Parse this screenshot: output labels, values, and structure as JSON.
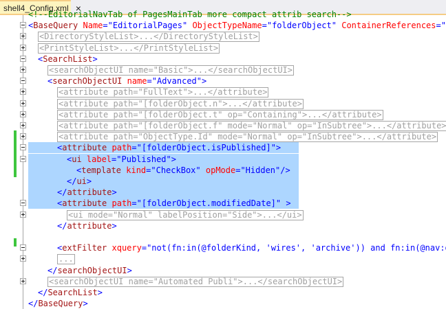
{
  "tab": {
    "title": "shell4_Config.xml",
    "close_glyph": "×"
  },
  "lines": [
    {
      "indent": 0,
      "fold": "none",
      "tokens": [
        [
          "c",
          "<!--EditorialNavTab of PagesMainTab more compact attrib search-->"
        ]
      ]
    },
    {
      "indent": 0,
      "fold": "minus",
      "tokens": [
        [
          "b",
          "<"
        ],
        [
          "t",
          "BaseQuery"
        ],
        [
          "a",
          " Name"
        ],
        [
          "b",
          "=\""
        ],
        [
          "v2",
          "EditorialPages"
        ],
        [
          "b",
          "\""
        ],
        [
          "a",
          " ObjectTypeName"
        ],
        [
          "b",
          "=\""
        ],
        [
          "v2",
          "folderObject"
        ],
        [
          "b",
          "\""
        ],
        [
          "a",
          " ContainerReferences"
        ],
        [
          "b",
          "=\"f"
        ]
      ]
    },
    {
      "indent": 1,
      "fold": "plus",
      "box": "<DirectoryStyleList>...</DirectoryStyleList>"
    },
    {
      "indent": 1,
      "fold": "plus",
      "box": "<PrintStyleList>...</PrintStyleList>"
    },
    {
      "indent": 1,
      "fold": "minus",
      "tokens": [
        [
          "b",
          "<"
        ],
        [
          "t",
          "SearchList"
        ],
        [
          "b",
          ">"
        ]
      ]
    },
    {
      "indent": 2,
      "fold": "plus",
      "box": "<searchObjectUI name=\"Basic\">...</searchObjectUI>"
    },
    {
      "indent": 2,
      "fold": "minus",
      "tokens": [
        [
          "b",
          "<"
        ],
        [
          "t",
          "searchObjectUI"
        ],
        [
          "a",
          " name"
        ],
        [
          "b",
          "=\""
        ],
        [
          "v2",
          "Advanced"
        ],
        [
          "b",
          "\">"
        ]
      ]
    },
    {
      "indent": 3,
      "fold": "plus",
      "box": "<attribute path=\"FullText\">...</attribute>"
    },
    {
      "indent": 3,
      "fold": "plus",
      "box": "<attribute path=\"[folderObject.n\">...</attribute>"
    },
    {
      "indent": 3,
      "fold": "plus",
      "box": "<attribute path=\"[folderObject.t\" op=\"Containing\">...</attribute>"
    },
    {
      "indent": 3,
      "fold": "plus",
      "box": "<attribute path=\"[folderObject.f\" mode=\"Normal\" op=\"InSubtree\">...</attribute>"
    },
    {
      "indent": 3,
      "fold": "plus",
      "box": "<attribute path=\"ObjectType.Id\" mode=\"Normal\" op=\"InSubtree\">...</attribute>"
    },
    {
      "indent": 3,
      "fold": "minus",
      "selected": true,
      "tokens": [
        [
          "b",
          "<"
        ],
        [
          "t",
          "attribute"
        ],
        [
          "a",
          " path"
        ],
        [
          "b",
          "=\""
        ],
        [
          "v2",
          "[folderObject.isPublished]"
        ],
        [
          "b",
          "\">"
        ]
      ]
    },
    {
      "indent": 4,
      "fold": "minus",
      "selected": true,
      "tokens": [
        [
          "b",
          "<"
        ],
        [
          "t",
          "ui"
        ],
        [
          "a",
          " label"
        ],
        [
          "b",
          "=\""
        ],
        [
          "v2",
          "Published"
        ],
        [
          "b",
          "\">"
        ]
      ]
    },
    {
      "indent": 5,
      "fold": "none",
      "selected": true,
      "tokens": [
        [
          "b",
          "<"
        ],
        [
          "t",
          "template"
        ],
        [
          "a",
          " kind"
        ],
        [
          "b",
          "=\""
        ],
        [
          "v2",
          "CheckBox"
        ],
        [
          "b",
          "\""
        ],
        [
          "a",
          " opMode"
        ],
        [
          "b",
          "=\""
        ],
        [
          "v2",
          "Hidden"
        ],
        [
          "b",
          "\"/>"
        ]
      ]
    },
    {
      "indent": 4,
      "fold": "none",
      "selected": true,
      "tokens": [
        [
          "b",
          "</"
        ],
        [
          "t",
          "ui"
        ],
        [
          "b",
          ">"
        ]
      ]
    },
    {
      "indent": 3,
      "fold": "none",
      "selected": true,
      "tokens": [
        [
          "b",
          "</"
        ],
        [
          "t",
          "attribute"
        ],
        [
          "b",
          ">"
        ]
      ]
    },
    {
      "indent": 3,
      "fold": "minus",
      "selected": true,
      "tokens": [
        [
          "b",
          "<"
        ],
        [
          "t",
          "attribute"
        ],
        [
          "a",
          " path"
        ],
        [
          "b",
          "=\""
        ],
        [
          "v2",
          "[folderObject.modifiedDate]"
        ],
        [
          "b",
          "\" >"
        ]
      ]
    },
    {
      "indent": 4,
      "fold": "plus",
      "box": "<ui mode=\"Normal\" labelPosition=\"Side\">...</ui>"
    },
    {
      "indent": 3,
      "fold": "none",
      "tokens": [
        [
          "b",
          "</"
        ],
        [
          "t",
          "attribute"
        ],
        [
          "b",
          ">"
        ]
      ]
    },
    {
      "indent": 0,
      "fold": "none",
      "tokens": []
    },
    {
      "indent": 3,
      "fold": "minus",
      "tokens": [
        [
          "b",
          "<"
        ],
        [
          "t",
          "extFilter"
        ],
        [
          "a",
          " xquery"
        ],
        [
          "b",
          "=\""
        ],
        [
          "v2",
          "not(fn:in(@folderKind, 'wires', 'archive')) and fn:in(@nav:o"
        ]
      ]
    },
    {
      "indent": 3,
      "fold": "plus",
      "box": "..."
    },
    {
      "indent": 2,
      "fold": "none",
      "tokens": [
        [
          "b",
          "</"
        ],
        [
          "t",
          "searchObjectUI"
        ],
        [
          "b",
          ">"
        ]
      ]
    },
    {
      "indent": 2,
      "fold": "plus",
      "box": "<searchObjectUI name=\"Automated Publi\">...</searchObjectUI>"
    },
    {
      "indent": 1,
      "fold": "none",
      "tokens": [
        [
          "b",
          "</"
        ],
        [
          "t",
          "SearchList"
        ],
        [
          "b",
          ">"
        ]
      ]
    },
    {
      "indent": 0,
      "fold": "none",
      "tokens": [
        [
          "b",
          "</"
        ],
        [
          "t",
          "BaseQuery"
        ],
        [
          "b",
          ">"
        ]
      ]
    }
  ]
}
